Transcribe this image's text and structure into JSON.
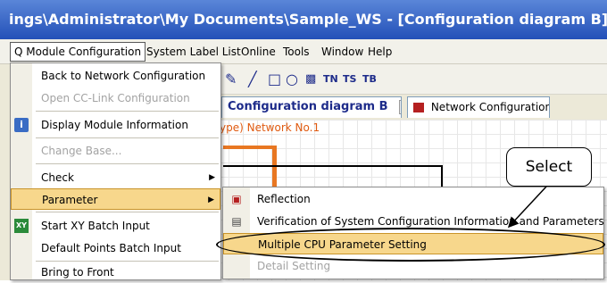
{
  "title": "ings\\Administrator\\My Documents\\Sample_WS - [Configuration diagram B]",
  "menubar": {
    "items": [
      "Q Module Configuration",
      "System Label List",
      "Online",
      "Tools",
      "Window",
      "Help"
    ]
  },
  "tabs": [
    {
      "label": "Configuration diagram B",
      "close": "×"
    },
    {
      "label": "Network Configuration"
    }
  ],
  "canvas": {
    "network_label": "ype) Network No.1"
  },
  "dropdown": {
    "items": [
      {
        "label": "Back to Network Configuration",
        "disabled": false
      },
      {
        "label": "Open CC-Link Configuration",
        "disabled": true
      },
      {
        "label": "Display Module Information",
        "disabled": false
      },
      {
        "label": "Change Base...",
        "disabled": true
      },
      {
        "label": "Check",
        "disabled": false
      },
      {
        "label": "Parameter",
        "disabled": false
      },
      {
        "label": "Start XY Batch Input",
        "disabled": false
      },
      {
        "label": "Default Points Batch Input",
        "disabled": false
      },
      {
        "label": "Bring to Front",
        "disabled": false
      }
    ]
  },
  "submenu": {
    "items": [
      {
        "label": "Reflection",
        "disabled": false
      },
      {
        "label": "Verification of System Configuration Information and Parameters",
        "disabled": false
      },
      {
        "label": "Multiple CPU Parameter Setting",
        "disabled": false
      },
      {
        "label": "Detail Setting",
        "disabled": true
      }
    ]
  },
  "callout": {
    "text": "Select"
  },
  "colors": {
    "highlight": "#f7d78c",
    "title_bar": "#2350b8",
    "orange": "#e87722"
  }
}
